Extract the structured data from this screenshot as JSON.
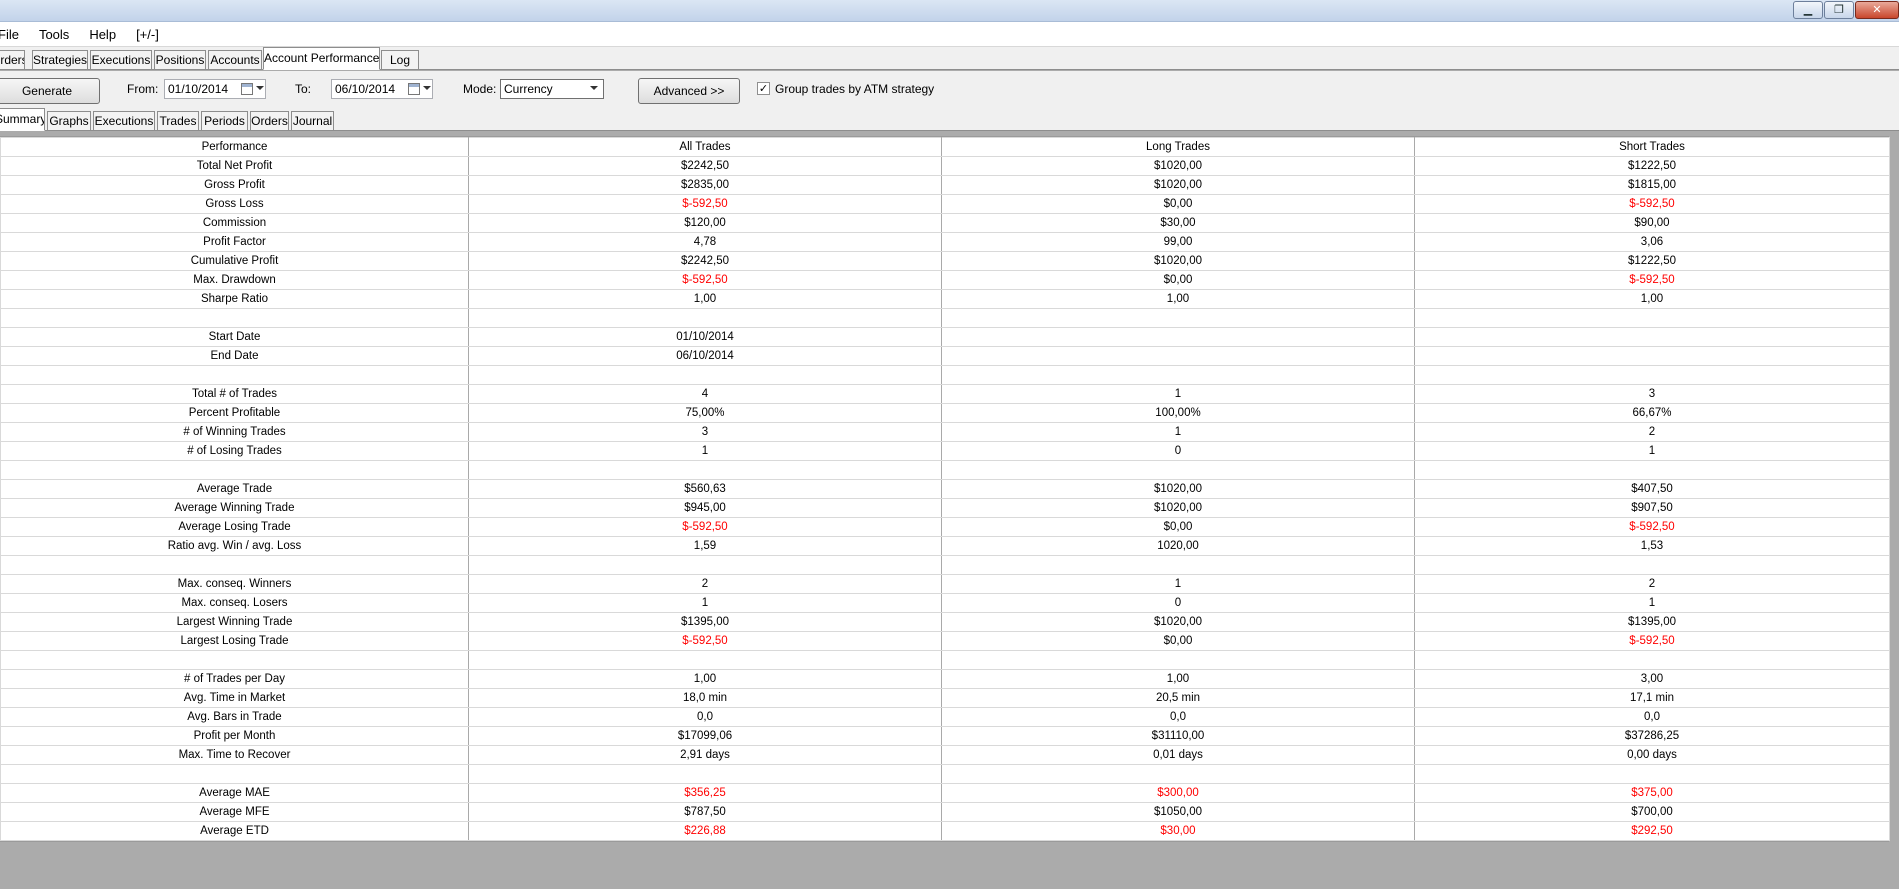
{
  "window": {
    "buttons": [
      {
        "name": "minimize-button",
        "glyph": "▁"
      },
      {
        "name": "restore-button",
        "glyph": "❐"
      },
      {
        "name": "close-button",
        "glyph": "✕"
      }
    ]
  },
  "menubar": {
    "items": [
      "File",
      "Tools",
      "Help",
      "[+/-]"
    ]
  },
  "tabs": [
    {
      "label": "Orders",
      "active": false
    },
    {
      "label": "Strategies",
      "active": false
    },
    {
      "label": "Executions",
      "active": false
    },
    {
      "label": "Positions",
      "active": false
    },
    {
      "label": "Accounts",
      "active": false
    },
    {
      "label": "Account Performance",
      "active": true
    },
    {
      "label": "Log",
      "active": false
    }
  ],
  "toolbar": {
    "generate_label": "Generate",
    "from_label": "From:",
    "from_value": "01/10/2014",
    "to_label": "To:",
    "to_value": "06/10/2014",
    "mode_label": "Mode:",
    "mode_value": "Currency",
    "advanced_label": "Advanced >>",
    "group_checked": true,
    "group_label": "Group trades by ATM strategy"
  },
  "subtabs": [
    {
      "label": "Summary",
      "active": true
    },
    {
      "label": "Graphs",
      "active": false
    },
    {
      "label": "Executions",
      "active": false
    },
    {
      "label": "Trades",
      "active": false
    },
    {
      "label": "Periods",
      "active": false
    },
    {
      "label": "Orders",
      "active": false
    },
    {
      "label": "Journal",
      "active": false
    }
  ],
  "colors": {
    "negative": "#ff0000"
  },
  "table": {
    "headers": [
      "Performance",
      "All Trades",
      "Long Trades",
      "Short Trades"
    ],
    "rows": [
      {
        "label": "Total Net Profit",
        "all": "$2242,50",
        "long": "$1020,00",
        "short": "$1222,50"
      },
      {
        "label": "Gross Profit",
        "all": "$2835,00",
        "long": "$1020,00",
        "short": "$1815,00"
      },
      {
        "label": "Gross Loss",
        "all": "$-592,50",
        "long": "$0,00",
        "short": "$-592,50",
        "neg": [
          "all",
          "short"
        ]
      },
      {
        "label": "Commission",
        "all": "$120,00",
        "long": "$30,00",
        "short": "$90,00"
      },
      {
        "label": "Profit Factor",
        "all": "4,78",
        "long": "99,00",
        "short": "3,06"
      },
      {
        "label": "Cumulative Profit",
        "all": "$2242,50",
        "long": "$1020,00",
        "short": "$1222,50"
      },
      {
        "label": "Max. Drawdown",
        "all": "$-592,50",
        "long": "$0,00",
        "short": "$-592,50",
        "neg": [
          "all",
          "short"
        ]
      },
      {
        "label": "Sharpe Ratio",
        "all": "1,00",
        "long": "1,00",
        "short": "1,00"
      },
      {
        "label": "",
        "all": "",
        "long": "",
        "short": ""
      },
      {
        "label": "Start Date",
        "all": "01/10/2014",
        "long": "",
        "short": ""
      },
      {
        "label": "End Date",
        "all": "06/10/2014",
        "long": "",
        "short": ""
      },
      {
        "label": "",
        "all": "",
        "long": "",
        "short": ""
      },
      {
        "label": "Total # of Trades",
        "all": "4",
        "long": "1",
        "short": "3"
      },
      {
        "label": "Percent Profitable",
        "all": "75,00%",
        "long": "100,00%",
        "short": "66,67%"
      },
      {
        "label": "# of Winning Trades",
        "all": "3",
        "long": "1",
        "short": "2"
      },
      {
        "label": "# of Losing Trades",
        "all": "1",
        "long": "0",
        "short": "1"
      },
      {
        "label": "",
        "all": "",
        "long": "",
        "short": ""
      },
      {
        "label": "Average Trade",
        "all": "$560,63",
        "long": "$1020,00",
        "short": "$407,50"
      },
      {
        "label": "Average Winning Trade",
        "all": "$945,00",
        "long": "$1020,00",
        "short": "$907,50"
      },
      {
        "label": "Average Losing Trade",
        "all": "$-592,50",
        "long": "$0,00",
        "short": "$-592,50",
        "neg": [
          "all",
          "short"
        ]
      },
      {
        "label": "Ratio avg. Win / avg. Loss",
        "all": "1,59",
        "long": "1020,00",
        "short": "1,53"
      },
      {
        "label": "",
        "all": "",
        "long": "",
        "short": ""
      },
      {
        "label": "Max. conseq. Winners",
        "all": "2",
        "long": "1",
        "short": "2"
      },
      {
        "label": "Max. conseq. Losers",
        "all": "1",
        "long": "0",
        "short": "1"
      },
      {
        "label": "Largest Winning Trade",
        "all": "$1395,00",
        "long": "$1020,00",
        "short": "$1395,00"
      },
      {
        "label": "Largest Losing Trade",
        "all": "$-592,50",
        "long": "$0,00",
        "short": "$-592,50",
        "neg": [
          "all",
          "short"
        ]
      },
      {
        "label": "",
        "all": "",
        "long": "",
        "short": ""
      },
      {
        "label": "# of Trades per Day",
        "all": "1,00",
        "long": "1,00",
        "short": "3,00"
      },
      {
        "label": "Avg. Time in Market",
        "all": "18,0 min",
        "long": "20,5 min",
        "short": "17,1 min"
      },
      {
        "label": "Avg. Bars in Trade",
        "all": "0,0",
        "long": "0,0",
        "short": "0,0"
      },
      {
        "label": "Profit per Month",
        "all": "$17099,06",
        "long": "$31110,00",
        "short": "$37286,25"
      },
      {
        "label": "Max. Time to Recover",
        "all": "2,91 days",
        "long": "0,01 days",
        "short": "0,00 days"
      },
      {
        "label": "",
        "all": "",
        "long": "",
        "short": ""
      },
      {
        "label": "Average MAE",
        "all": "$356,25",
        "long": "$300,00",
        "short": "$375,00",
        "neg": [
          "all",
          "long",
          "short"
        ]
      },
      {
        "label": "Average MFE",
        "all": "$787,50",
        "long": "$1050,00",
        "short": "$700,00"
      },
      {
        "label": "Average ETD",
        "all": "$226,88",
        "long": "$30,00",
        "short": "$292,50",
        "neg": [
          "all",
          "long",
          "short"
        ]
      }
    ]
  }
}
